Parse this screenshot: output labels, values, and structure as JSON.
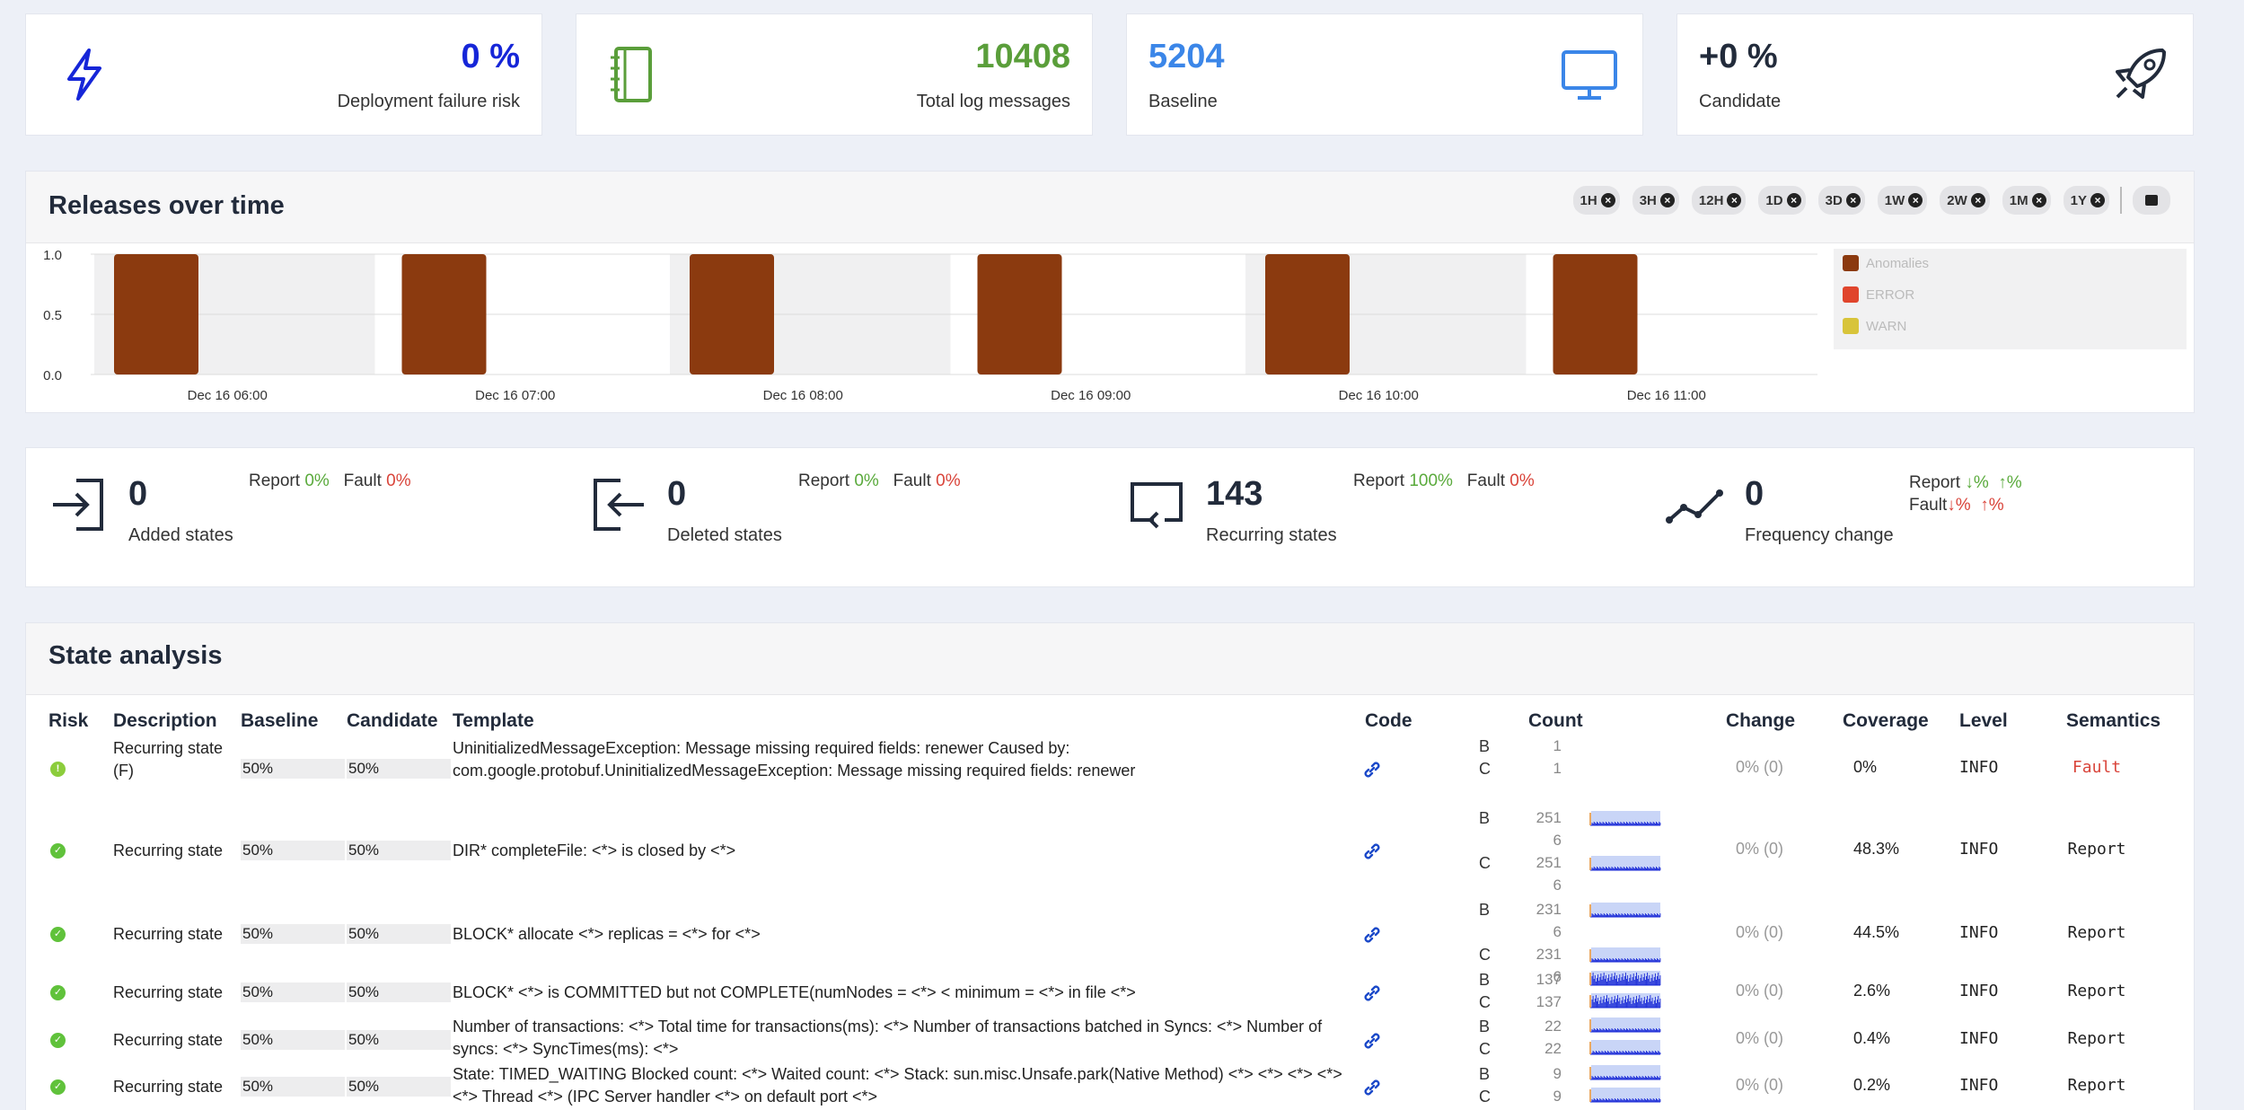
{
  "kpis": [
    {
      "value": "0 %",
      "label": "Deployment failure risk",
      "icon": "lightning-icon",
      "color": "#1626d8"
    },
    {
      "value": "10408",
      "label": "Total log messages",
      "icon": "notebook-icon",
      "color": "#5a9e3a"
    },
    {
      "value": "5204",
      "label": "Baseline",
      "icon": "monitor-icon",
      "color": "#3b86e8"
    },
    {
      "value": "+0 %",
      "label": "Candidate",
      "icon": "rocket-icon",
      "color": "#222b3b"
    }
  ],
  "releases": {
    "title": "Releases over time",
    "ranges": [
      "1H",
      "3H",
      "12H",
      "1D",
      "3D",
      "1W",
      "2W",
      "1M",
      "1Y"
    ],
    "calendar_icon": "calendar-icon"
  },
  "chart_data": {
    "type": "bar",
    "categories": [
      "Dec 16 06:00",
      "Dec 16 07:00",
      "Dec 16 08:00",
      "Dec 16 09:00",
      "Dec 16 10:00",
      "Dec 16 11:00"
    ],
    "yticks": [
      "0.0",
      "0.5",
      "1.0"
    ],
    "ylim": [
      0,
      1
    ],
    "series": [
      {
        "name": "Anomalies",
        "color": "#8b3a0f",
        "values": [
          1,
          1,
          1,
          1,
          1,
          1
        ]
      },
      {
        "name": "ERROR",
        "color": "#e0452c",
        "values": [
          0,
          0,
          0,
          0,
          0,
          0
        ]
      },
      {
        "name": "WARN",
        "color": "#d8c43a",
        "values": [
          0,
          0,
          0,
          0,
          0,
          0
        ]
      }
    ],
    "legend": "right"
  },
  "states": [
    {
      "count": "0",
      "label": "Added states",
      "icon": "sign-in-icon",
      "report_label": "Report",
      "report": "0%",
      "fault_label": "Fault",
      "fault": "0%"
    },
    {
      "count": "0",
      "label": "Deleted states",
      "icon": "sign-out-icon",
      "report_label": "Report",
      "report": "0%",
      "fault_label": "Fault",
      "fault": "0%"
    },
    {
      "count": "143",
      "label": "Recurring states",
      "icon": "recurring-icon",
      "report_label": "Report",
      "report": "100%",
      "fault_label": "Fault",
      "fault": "0%"
    },
    {
      "count": "0",
      "label": "Frequency change",
      "icon": "trend-icon",
      "report_label": "Report",
      "report_down": "%",
      "report_up": "%",
      "fault_label": "Fault",
      "fault_down": "%",
      "fault_up": "%"
    }
  ],
  "analysis": {
    "title": "State analysis",
    "headers": {
      "risk": "Risk",
      "description": "Description",
      "baseline": "Baseline",
      "candidate": "Candidate",
      "template": "Template",
      "code": "Code",
      "count": "Count",
      "change": "Change",
      "coverage": "Coverage",
      "level": "Level",
      "semantics": "Semantics"
    },
    "rows": [
      {
        "risk": "warn",
        "description": "Recurring state (F)",
        "baseline": "50%",
        "candidate": "50%",
        "template": "UninitializedMessageException: Message missing required fields: renewer Caused by: com.google.protobuf.UninitializedMessageException: Message missing required fields: renewer",
        "b_label": "B",
        "c_label": "C",
        "b_count": "1",
        "c_count": "1",
        "change": "0% (0)",
        "coverage": "0%",
        "level": "INFO",
        "semantics": "Fault"
      },
      {
        "risk": "ok",
        "description": "Recurring state",
        "baseline": "50%",
        "candidate": "50%",
        "template": "DIR* completeFile: <*> is closed by <*>",
        "b_label": "B",
        "c_label": "C",
        "b_count": "251",
        "b_count2": "6",
        "c_count": "251",
        "c_count2": "6",
        "change": "0% (0)",
        "coverage": "48.3%",
        "level": "INFO",
        "semantics": "Report"
      },
      {
        "risk": "ok",
        "description": "Recurring state",
        "baseline": "50%",
        "candidate": "50%",
        "template": "BLOCK* allocate <*> replicas = <*> for <*>",
        "b_label": "B",
        "c_label": "C",
        "b_count": "231",
        "b_count2": "6",
        "c_count": "231",
        "c_count2": "6",
        "change": "0% (0)",
        "coverage": "44.5%",
        "level": "INFO",
        "semantics": "Report"
      },
      {
        "risk": "ok",
        "description": "Recurring state",
        "baseline": "50%",
        "candidate": "50%",
        "template": "BLOCK* <*> is COMMITTED but not COMPLETE(numNodes = <*> < minimum = <*> in file <*>",
        "b_label": "B",
        "c_label": "C",
        "b_count": "137",
        "c_count": "137",
        "change": "0% (0)",
        "coverage": "2.6%",
        "level": "INFO",
        "semantics": "Report"
      },
      {
        "risk": "ok",
        "description": "Recurring state",
        "baseline": "50%",
        "candidate": "50%",
        "template": "Number of transactions: <*> Total time for transactions(ms): <*> Number of transactions batched in Syncs: <*> Number of syncs: <*> SyncTimes(ms): <*>",
        "b_label": "B",
        "c_label": "C",
        "b_count": "22",
        "c_count": "22",
        "change": "0% (0)",
        "coverage": "0.4%",
        "level": "INFO",
        "semantics": "Report"
      },
      {
        "risk": "ok",
        "description": "Recurring state",
        "baseline": "50%",
        "candidate": "50%",
        "template": "State: TIMED_WAITING Blocked count: <*> Waited count: <*> Stack: sun.misc.Unsafe.park(Native Method) <*> <*> <*> <*> <*> Thread <*> (IPC Server handler <*> on default port <*>",
        "b_label": "B",
        "c_label": "C",
        "b_count": "9",
        "c_count": "9",
        "change": "0% (0)",
        "coverage": "0.2%",
        "level": "INFO",
        "semantics": "Report"
      }
    ]
  }
}
